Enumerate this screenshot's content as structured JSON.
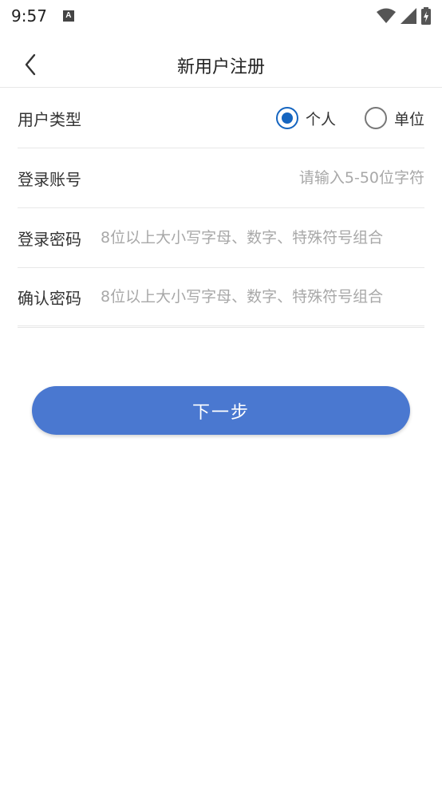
{
  "status_bar": {
    "time": "9:57",
    "notification_icon": "a-icon",
    "wifi_icon": "wifi-icon",
    "signal_icon": "signal-icon",
    "battery_icon": "battery-charging-icon"
  },
  "nav": {
    "title": "新用户注册",
    "back_icon": "chevron-left-icon"
  },
  "form": {
    "user_type": {
      "label": "用户类型",
      "options": [
        "个人",
        "单位"
      ],
      "selected": "个人"
    },
    "account": {
      "label": "登录账号",
      "placeholder": "请输入5-50位字符",
      "value": ""
    },
    "password": {
      "label": "登录密码",
      "placeholder": "8位以上大小写字母、数字、特殊符号组合",
      "value": ""
    },
    "confirm_password": {
      "label": "确认密码",
      "placeholder": "8位以上大小写字母、数字、特殊符号组合",
      "value": ""
    }
  },
  "next_button": {
    "label": "下一步"
  },
  "colors": {
    "primary": "#4a78d0",
    "radio_checked": "#1565c0",
    "placeholder": "#a8a8a8"
  }
}
